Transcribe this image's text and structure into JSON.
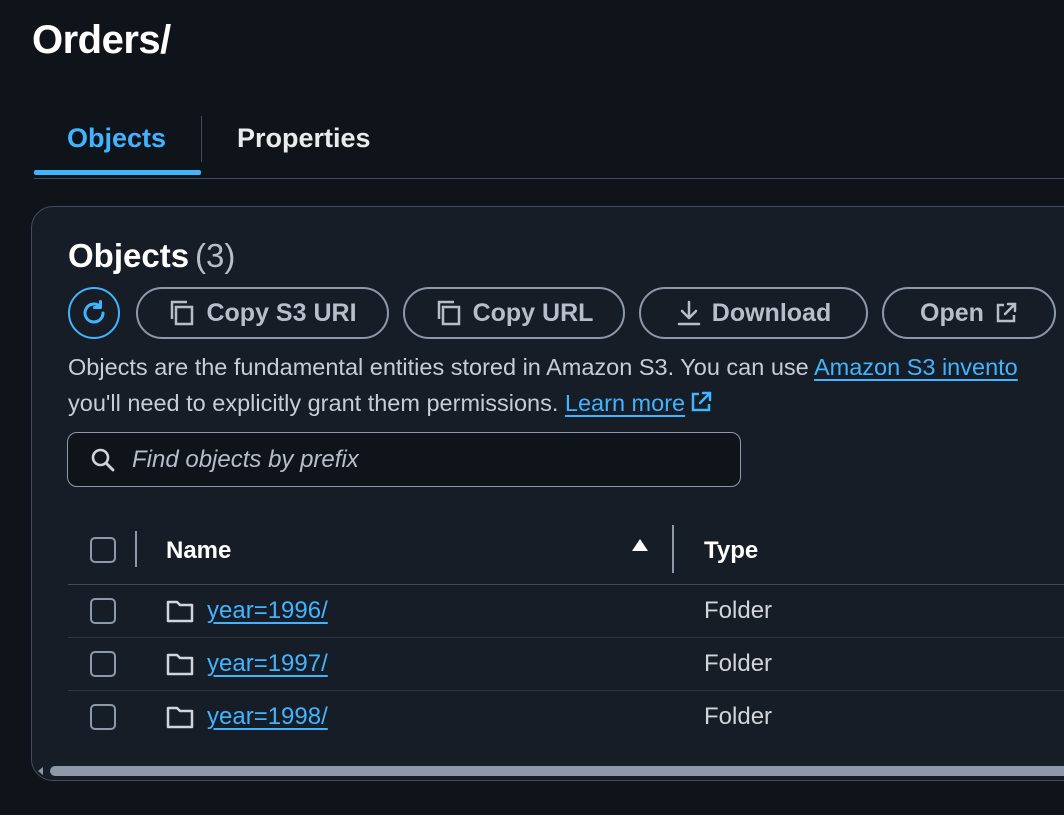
{
  "page": {
    "title": "Orders/"
  },
  "tabs": [
    {
      "label": "Objects",
      "active": true
    },
    {
      "label": "Properties",
      "active": false
    }
  ],
  "objects_panel": {
    "heading": "Objects",
    "count": "(3)",
    "actions": {
      "refresh": "refresh-icon",
      "copy_s3_uri": "Copy S3 URI",
      "copy_url": "Copy URL",
      "download": "Download",
      "open": "Open"
    },
    "description": {
      "line1_text": "Objects are the fundamental entities stored in Amazon S3. You can use ",
      "line1_link": "Amazon S3 invento",
      "line2_text": "you'll need to explicitly grant them permissions. ",
      "learn_more": "Learn more"
    },
    "search": {
      "placeholder": "Find objects by prefix",
      "value": ""
    },
    "table": {
      "columns": {
        "name": "Name",
        "type": "Type"
      },
      "sort": "ascending",
      "rows": [
        {
          "name": "year=1996/",
          "type": "Folder"
        },
        {
          "name": "year=1997/",
          "type": "Folder"
        },
        {
          "name": "year=1998/",
          "type": "Folder"
        }
      ]
    }
  },
  "colors": {
    "background": "#0f141a",
    "panel": "#161d26",
    "accent": "#42b4ff",
    "border": "#414d5c"
  }
}
